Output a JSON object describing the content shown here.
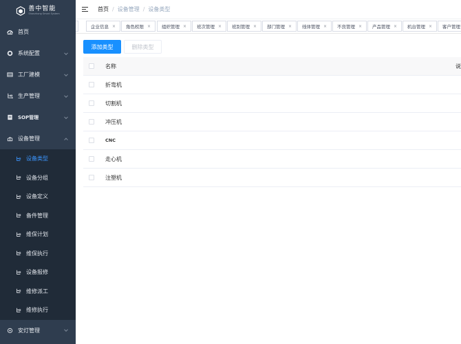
{
  "app": {
    "logo_title": "善中智能",
    "logo_sub": "Shanzhong Smart System"
  },
  "sidebar": {
    "items": [
      {
        "label": "首页",
        "icon": "dashboard-icon"
      },
      {
        "label": "系统配置",
        "icon": "gear-icon"
      },
      {
        "label": "工厂建模",
        "icon": "factory-icon"
      },
      {
        "label": "生产管理",
        "icon": "tree-icon"
      },
      {
        "label": "SOP管理",
        "icon": "document-icon"
      },
      {
        "label": "设备管理",
        "icon": "equipment-icon"
      },
      {
        "label": "安灯管理",
        "icon": "andon-icon"
      }
    ],
    "submenu": [
      {
        "label": "设备类型",
        "active": true
      },
      {
        "label": "设备分组"
      },
      {
        "label": "设备定义"
      },
      {
        "label": "备件管理"
      },
      {
        "label": "维保计划"
      },
      {
        "label": "维保执行"
      },
      {
        "label": "设备报修"
      },
      {
        "label": "维修派工"
      },
      {
        "label": "维修执行"
      }
    ]
  },
  "header": {
    "breadcrumb": [
      "首页",
      "设备管理",
      "设备类型"
    ]
  },
  "tags": [
    {
      "label": "企业信息"
    },
    {
      "label": "角色权限"
    },
    {
      "label": "组织管理"
    },
    {
      "label": "班次管理"
    },
    {
      "label": "班别管理"
    },
    {
      "label": "部门管理"
    },
    {
      "label": "线体管理"
    },
    {
      "label": "不良管理"
    },
    {
      "label": "产品管理"
    },
    {
      "label": "机台管理"
    },
    {
      "label": "客户管理"
    }
  ],
  "toolbar": {
    "add_label": "添加类型",
    "delete_label": "删除类型"
  },
  "table": {
    "columns": [
      "名称",
      "说"
    ],
    "rows": [
      "折弯机",
      "切割机",
      "冲压机",
      "CNC",
      "走心机",
      "注塑机"
    ]
  },
  "colors": {
    "sidebar_bg": "#2f3d4f",
    "submenu_bg": "#202b38",
    "accent": "#1890ff",
    "active_text": "#3b96ff"
  }
}
